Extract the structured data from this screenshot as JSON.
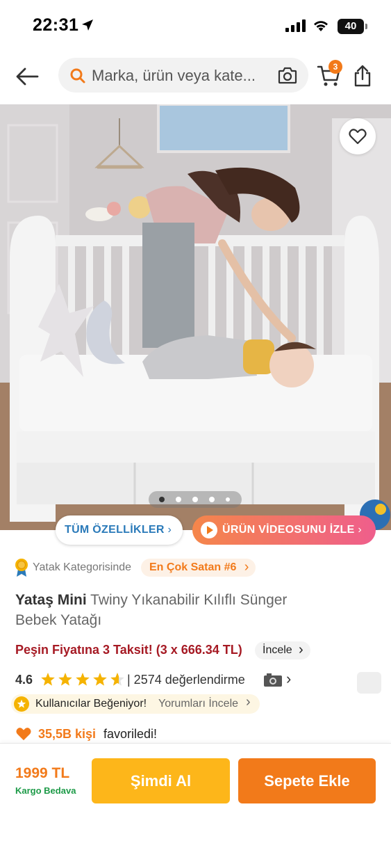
{
  "status_bar": {
    "time": "22:31",
    "battery": "40",
    "icons": [
      "location-arrow-icon",
      "signal-icon",
      "wifi-icon",
      "battery-icon"
    ]
  },
  "header": {
    "search_placeholder": "Marka, ürün veya kate...",
    "cart_count": "3",
    "icons": [
      "back-arrow-icon",
      "search-icon",
      "camera-icon",
      "cart-icon",
      "share-icon"
    ]
  },
  "gallery": {
    "image_description": "baby-crib-product-photo",
    "total_images": 5,
    "active_index": 1,
    "features_button": "TÜM ÖZELLİKLER",
    "features_chevron": "›",
    "video_button": "ÜRÜN VİDEOSUNU İZLE",
    "video_chevron": "›"
  },
  "product": {
    "category_label": "Yatak Kategorisinde",
    "bestseller_label": "En Çok Satan #6",
    "brand": "Yataş Mini",
    "name": "Twiny Yıkanabilir Kılıflı Sünger Bebek Yatağı",
    "installment_text": "Peşin Fiyatına 3 Taksit! (3 x 666.34 TL)",
    "installment_link": "İncele",
    "rating": "4.6",
    "rating_stars": 4.6,
    "review_count_text": "| 2574 değerlendirme",
    "review_chevron": "›",
    "liked_text": "Kullanıcılar Beğeniyor!",
    "liked_link": "Yorumları İncele",
    "liked_chevron": "›",
    "favorites_count": "35,5B kişi",
    "favorites_text": "favoriledi!"
  },
  "bottom_bar": {
    "price": "1999 TL",
    "shipping": "Kargo Bedava",
    "buy_now": "Şimdi Al",
    "add_to_cart": "Sepete Ekle"
  },
  "colors": {
    "brand_orange": "#f27a1a",
    "buy_now_yellow": "#fdb61a",
    "installment_red": "#a61a24",
    "shipping_green": "#1c9a47",
    "link_blue": "#2a7ab9"
  }
}
